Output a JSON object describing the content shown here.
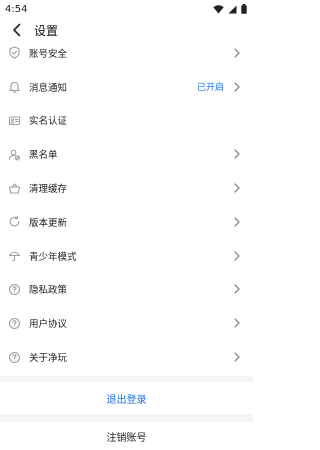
{
  "status_bar": {
    "time": "4:54"
  },
  "header": {
    "title": "设置"
  },
  "settings": {
    "items": [
      {
        "label": "账号安全",
        "icon": "shield-icon",
        "status": "",
        "chevron": true
      },
      {
        "label": "消息通知",
        "icon": "bell-icon",
        "status": "已开启",
        "chevron": true
      },
      {
        "label": "实名认证",
        "icon": "id-card-icon",
        "status": "",
        "chevron": false
      },
      {
        "label": "黑名单",
        "icon": "user-block-icon",
        "status": "",
        "chevron": true
      },
      {
        "label": "清理缓存",
        "icon": "basket-icon",
        "status": "",
        "chevron": true
      },
      {
        "label": "版本更新",
        "icon": "refresh-icon",
        "status": "",
        "chevron": true
      },
      {
        "label": "青少年模式",
        "icon": "umbrella-icon",
        "status": "",
        "chevron": true
      },
      {
        "label": "隐私政策",
        "icon": "help-circle-icon",
        "status": "",
        "chevron": true
      },
      {
        "label": "用户协议",
        "icon": "help-circle-icon",
        "status": "",
        "chevron": true
      },
      {
        "label": "关于净玩",
        "icon": "help-circle-icon",
        "status": "",
        "chevron": true
      }
    ]
  },
  "actions": {
    "logout": "退出登录",
    "cancel_account": "注销账号"
  },
  "colors": {
    "accent": "#1a73e8",
    "icon": "#9aa0a6",
    "band": "#f4f4f6"
  }
}
